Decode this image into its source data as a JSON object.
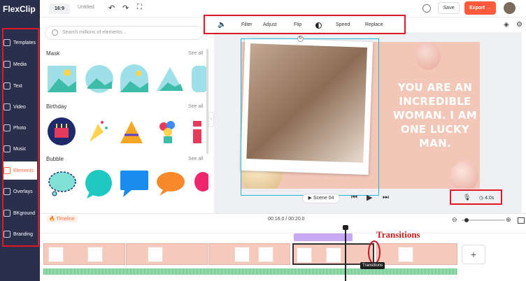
{
  "app": {
    "logo": "FlexClip",
    "logo_accent": "F"
  },
  "topbar": {
    "ratio": "16:9",
    "title": "Untitled",
    "save_label": "Save",
    "export_label": "Export"
  },
  "sidebar": {
    "items": [
      {
        "label": "Templates",
        "icon": "templates-icon"
      },
      {
        "label": "Media",
        "icon": "folder-icon"
      },
      {
        "label": "Text",
        "icon": "text-icon"
      },
      {
        "label": "Video",
        "icon": "video-icon"
      },
      {
        "label": "Photo",
        "icon": "photo-icon"
      },
      {
        "label": "Music",
        "icon": "music-icon"
      },
      {
        "label": "Elements",
        "icon": "elements-icon"
      },
      {
        "label": "Overlays",
        "icon": "overlays-icon"
      },
      {
        "label": "BKground",
        "icon": "background-icon"
      },
      {
        "label": "Branding",
        "icon": "branding-icon"
      }
    ],
    "active": "Elements"
  },
  "elements_panel": {
    "search_placeholder": "Search millions of elements...",
    "sections": [
      {
        "title": "Mask",
        "see_all": "See all"
      },
      {
        "title": "Birthday",
        "see_all": "See all"
      },
      {
        "title": "Bubble",
        "see_all": "See all"
      }
    ]
  },
  "edit_toolbar": {
    "filter": "Filter",
    "adjust": "Adjust",
    "flip": "Flip",
    "speed": "Speed",
    "replace": "Replace"
  },
  "canvas": {
    "quote": "YOU ARE AN INCREDIBLE WOMAN. I AM ONE LUCKY MAN."
  },
  "player": {
    "scene_label": "Scene 04",
    "duration": "4.0s"
  },
  "timeline": {
    "label": "Timeline",
    "time": "00:16.0 / 00:20.0"
  },
  "annotation": {
    "transitions_label": "Transitions",
    "tooltip": "Transitions"
  },
  "colors": {
    "accent": "#ff5a3c",
    "sidebar_bg": "#2a2f4c",
    "highlight_red": "#e0182a",
    "selection": "#29b6d6"
  }
}
